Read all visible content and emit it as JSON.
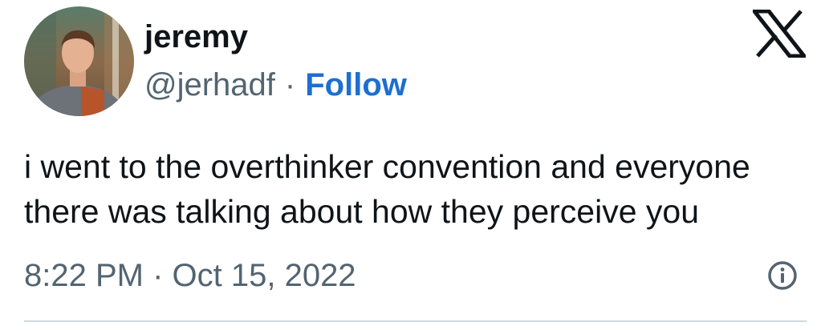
{
  "author": {
    "display_name": "jeremy",
    "handle": "@jerhadf",
    "separator": "·",
    "follow_label": "Follow",
    "avatar_icon": "profile-photo"
  },
  "brand": {
    "logo_icon": "x-logo"
  },
  "tweet": {
    "lines": [
      "i went to the overthinker convention and everyone",
      "there was talking about how they perceive you"
    ],
    "timestamp": "8:22 PM · Oct 15, 2022"
  },
  "actions": {
    "info_icon": "info-icon"
  },
  "colors": {
    "text": "#0f1419",
    "secondary": "#536471",
    "link": "#1d6fd0",
    "divider": "#cfd9de"
  }
}
